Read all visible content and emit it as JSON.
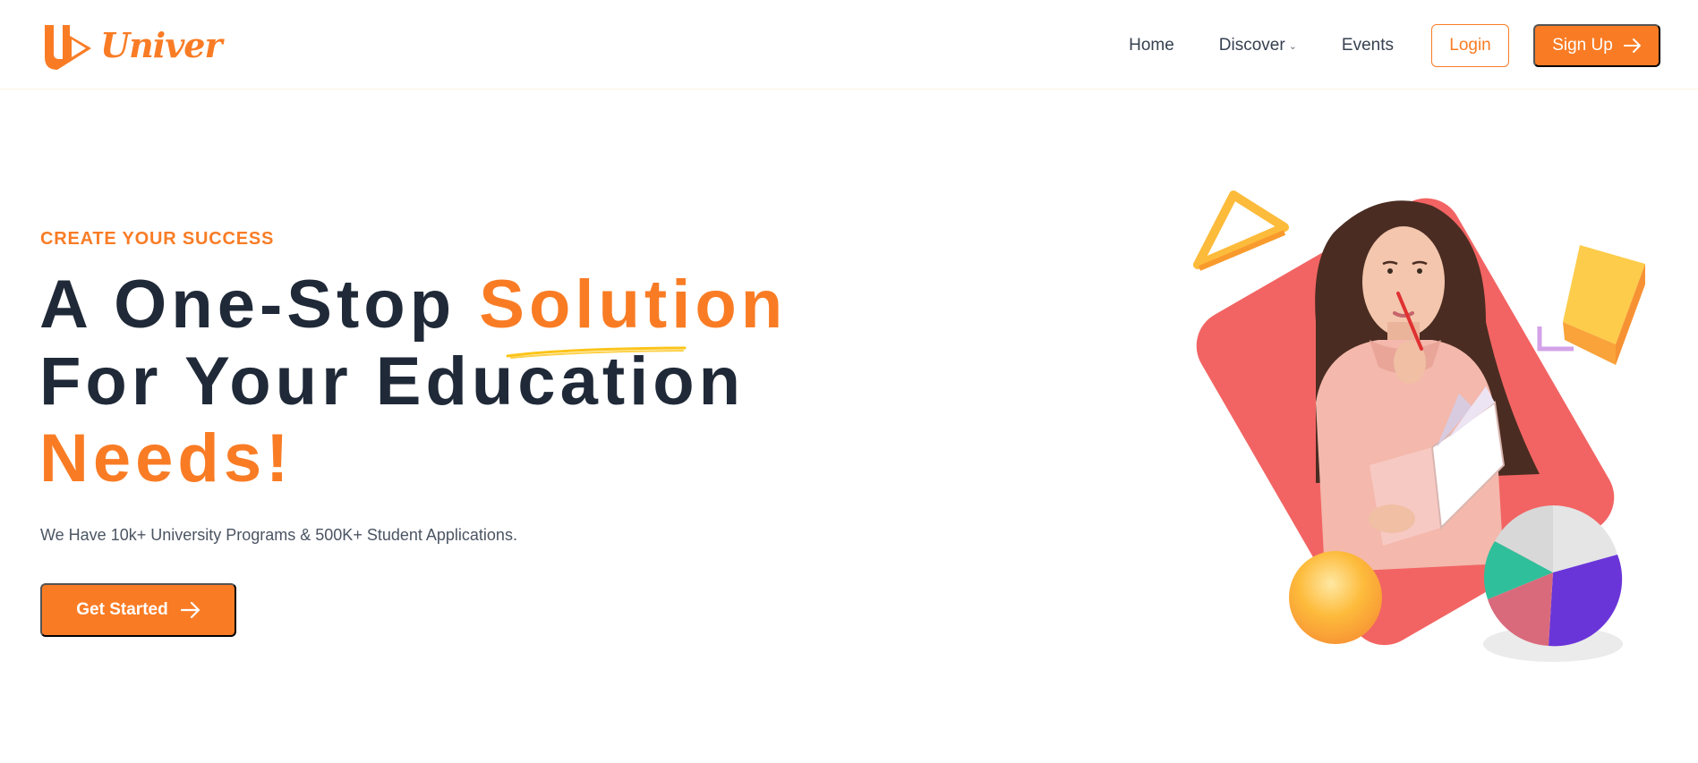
{
  "brand": {
    "name": "Univer",
    "color": "#f97c25"
  },
  "nav": {
    "items": [
      {
        "label": "Home"
      },
      {
        "label": "Discover",
        "icon": "chevron-down-icon"
      },
      {
        "label": "Events"
      }
    ],
    "login_label": "Login",
    "signup_label": "Sign Up"
  },
  "hero": {
    "eyebrow": "CREATE YOUR SUCCESS",
    "headline_part1": "A One-Stop ",
    "headline_highlight1": "Solution",
    "headline_line2": "For Your Education",
    "headline_highlight2": "Needs!",
    "subtext": "We Have 10k+ University Programs & 500K+ Student Applications.",
    "cta_label": "Get Started",
    "illustration": "student-with-book-illustration"
  },
  "colors": {
    "accent": "#f97c25",
    "heading": "#1f2937",
    "coral": "#f26463",
    "yellow": "#fdbb3b",
    "purple": "#6a35d8",
    "teal": "#2fbf9a"
  }
}
